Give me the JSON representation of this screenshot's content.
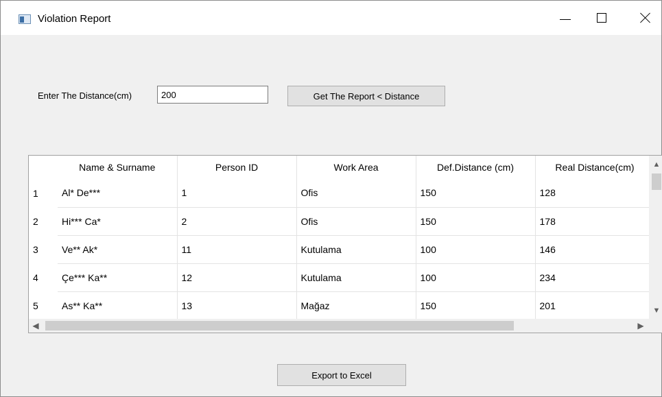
{
  "window": {
    "title": "Violation Report",
    "icons": {
      "app": "app-window-icon",
      "minimize": "minimize-icon",
      "maximize": "maximize-icon",
      "close": "close-icon"
    }
  },
  "filter": {
    "distance_label": "Enter The Distance(cm)",
    "distance_value": "200",
    "report_button": "Get The Report < Distance"
  },
  "table": {
    "columns": [
      "Name & Surname",
      "Person ID",
      "Work Area",
      "Def.Distance (cm)",
      "Real Distance(cm)"
    ],
    "rows": [
      {
        "num": "1",
        "cells": [
          "Al* De***",
          "1",
          "Ofis",
          "150",
          "128"
        ]
      },
      {
        "num": "2",
        "cells": [
          "Hi*** Ca*",
          "2",
          "Ofis",
          "150",
          "178"
        ]
      },
      {
        "num": "3",
        "cells": [
          "Ve** Ak*",
          "11",
          "Kutulama",
          "100",
          "146"
        ]
      },
      {
        "num": "4",
        "cells": [
          "Çe*** Ka**",
          "12",
          "Kutulama",
          "100",
          "234"
        ]
      },
      {
        "num": "5",
        "cells": [
          "As** Ka**",
          "13",
          "Mağaz",
          "150",
          "201"
        ]
      }
    ],
    "scroll_icons": {
      "up": "chevron-up-icon",
      "down": "chevron-down-icon",
      "left": "chevron-left-icon",
      "right": "chevron-right-icon"
    }
  },
  "footer": {
    "export_button": "Export to Excel"
  }
}
